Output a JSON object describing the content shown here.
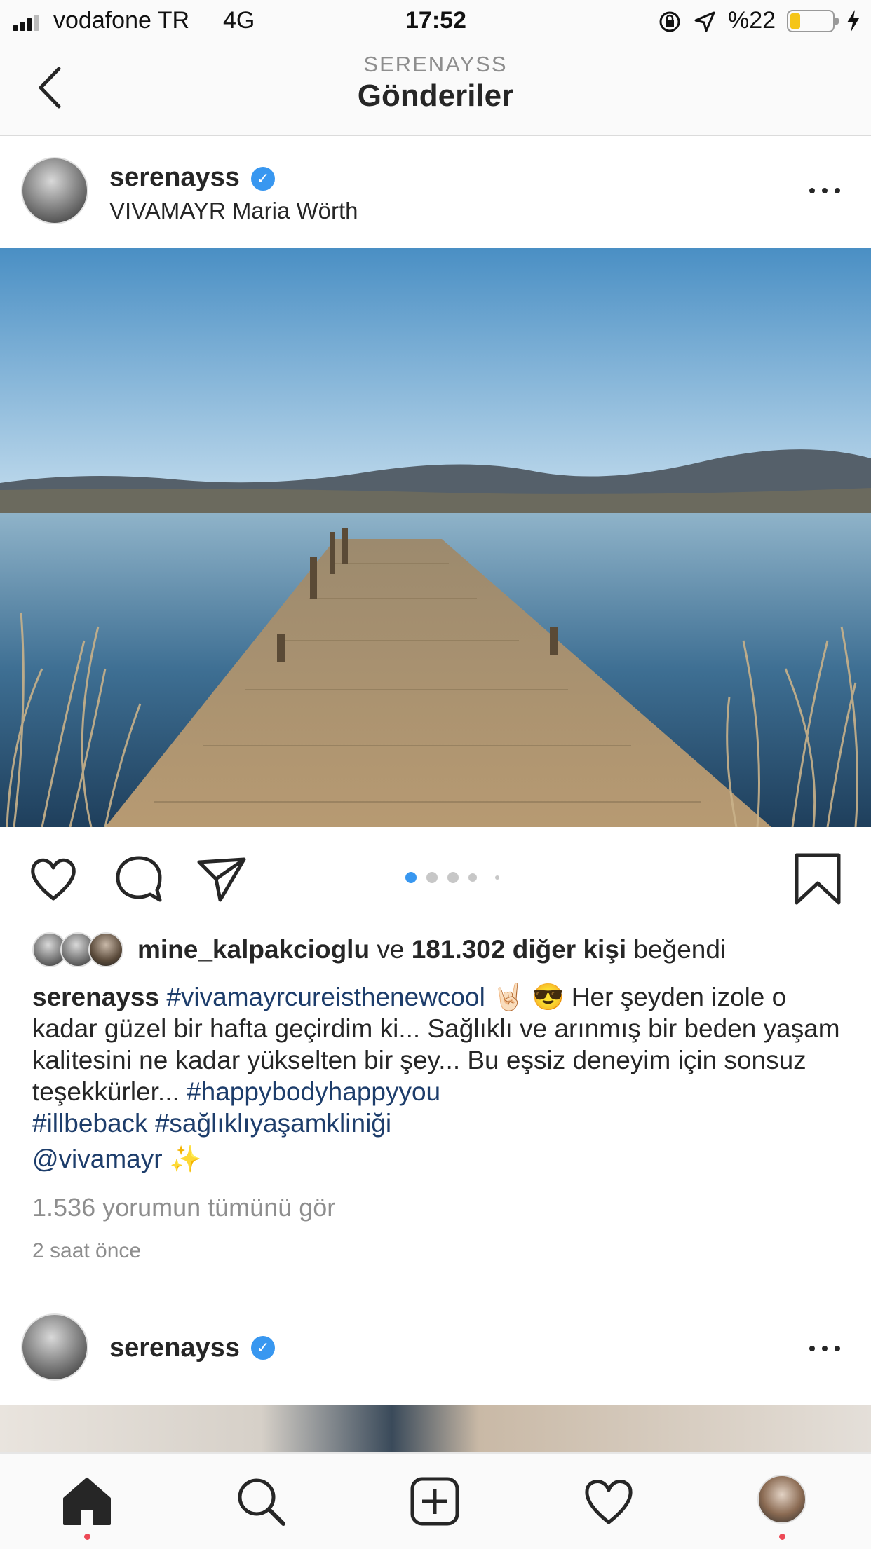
{
  "status_bar": {
    "carrier": "vodafone TR",
    "network": "4G",
    "time": "17:52",
    "battery": "%22",
    "battery_level": 0.22
  },
  "nav": {
    "subtitle": "SERENAYSS",
    "title": "Gönderiler"
  },
  "post": {
    "username": "serenayss",
    "location": "VIVAMAYR Maria Wörth",
    "carousel_count": 5,
    "carousel_active": 1,
    "liked_by_user": "mine_kalpakcioglu",
    "liked_connector": "ve",
    "liked_count": "181.302 diğer kişi",
    "liked_suffix": "beğendi",
    "caption_username": "serenayss",
    "caption_tag1": "#vivamayrcureisthenewcool",
    "caption_emoji": "🤘🏻 😎",
    "caption_text": "Her şeyden izole o kadar güzel bir hafta geçirdim ki... Sağlıklı ve arınmış bir beden yaşam kalitesini ne kadar yükselten bir şey... Bu eşsiz deneyim için sonsuz teşekkürler...",
    "caption_tag2": "#happybodyhappyyou",
    "caption_tag3": "#illbeback",
    "caption_tag4": "#sağlıklıyaşamkliniği",
    "caption_mention": "@vivamayr",
    "caption_sparkle": "✨",
    "comments_link": "1.536 yorumun tümünü gör",
    "timestamp": "2 saat önce"
  },
  "next_post": {
    "username": "serenayss"
  },
  "icons": {
    "back": "chevron-left-icon",
    "verified": "verified-badge-icon",
    "more": "more-dots-icon",
    "like": "heart-icon",
    "comment": "comment-icon",
    "share": "send-icon",
    "save": "bookmark-icon",
    "home": "home-icon",
    "search": "search-icon",
    "add": "add-post-icon",
    "activity": "heart-icon",
    "profile": "profile-avatar"
  },
  "colors": {
    "link_blue": "#1d3d6b",
    "verified_blue": "#3897f0",
    "muted_gray": "#8e8e8e",
    "notification_red": "#ed4956"
  }
}
